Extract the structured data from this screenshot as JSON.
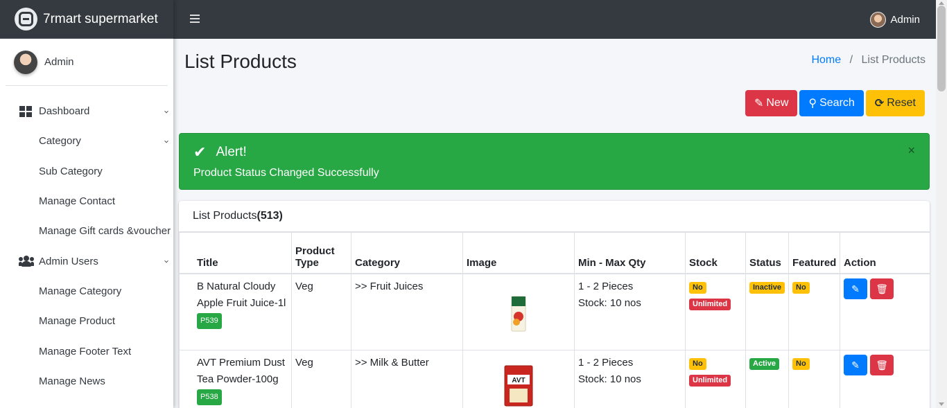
{
  "brand": {
    "name": "7rmart supermarket"
  },
  "sidebar": {
    "user": "Admin",
    "items": [
      {
        "label": "Dashboard",
        "type": "main",
        "icon": "dashboard-icon"
      },
      {
        "label": "Category",
        "type": "sub"
      },
      {
        "label": "Sub Category",
        "type": "sub"
      },
      {
        "label": "Manage Contact",
        "type": "sub"
      },
      {
        "label": "Manage Gift cards &voucher",
        "type": "sub"
      },
      {
        "label": "Admin Users",
        "type": "main",
        "icon": "users-icon"
      },
      {
        "label": "Manage Category",
        "type": "sub"
      },
      {
        "label": "Manage Product",
        "type": "sub"
      },
      {
        "label": "Manage Footer Text",
        "type": "sub"
      },
      {
        "label": "Manage News",
        "type": "sub"
      }
    ]
  },
  "topbar": {
    "user": "Admin"
  },
  "page": {
    "title": "List Products",
    "breadcrumb": {
      "home": "Home",
      "current": "List Products"
    }
  },
  "actions": {
    "new": "New",
    "search": "Search",
    "reset": "Reset"
  },
  "alert": {
    "title": "Alert!",
    "message": "Product Status Changed Successfully",
    "close": "×"
  },
  "card": {
    "title_prefix": "List Products",
    "count": "(513)"
  },
  "table": {
    "headers": {
      "title": "Title",
      "type_line1": "Product",
      "type_line2": "Type",
      "category": "Category",
      "image": "Image",
      "qty": "Min - Max Qty",
      "stock": "Stock",
      "status": "Status",
      "featured": "Featured",
      "action": "Action"
    },
    "rows": [
      {
        "title_line1": "B Natural Cloudy",
        "title_line2": "Apple Fruit Juice-1l",
        "code": "P539",
        "type": "Veg",
        "category": ">> Fruit Juices",
        "qty": "1 - 2 Pieces",
        "stock_text": "Stock: 10 nos",
        "stock_badge": "No",
        "limit_badge": "Unlimited",
        "status": "Inactive",
        "featured": "No"
      },
      {
        "title_line1": "AVT Premium Dust",
        "title_line2": "Tea Powder-100g",
        "code": "P538",
        "type": "Veg",
        "category": ">> Milk & Butter",
        "qty": "1 - 2 Pieces",
        "stock_text": "Stock: 10 nos",
        "stock_badge": "No",
        "limit_badge": "Unlimited",
        "status": "Active",
        "featured": "No"
      }
    ]
  }
}
